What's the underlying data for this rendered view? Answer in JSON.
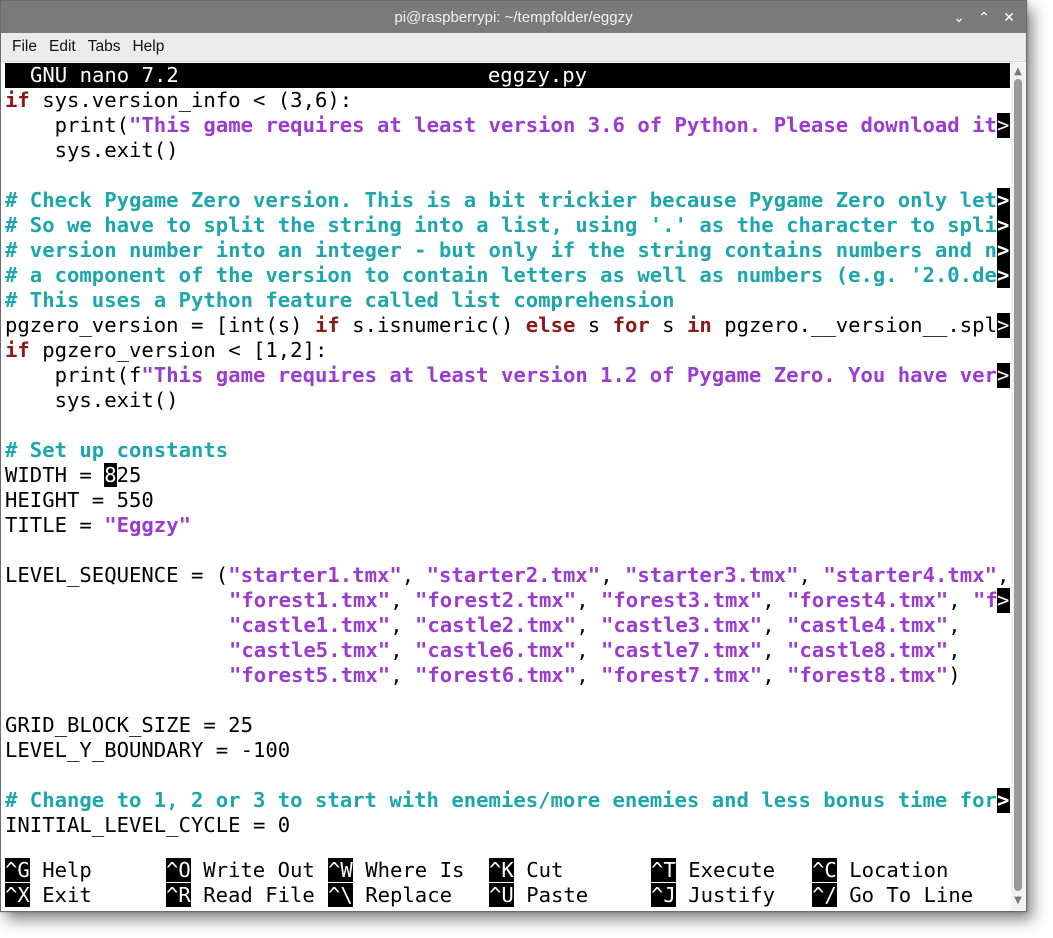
{
  "window": {
    "title": "pi@raspberrypi: ~/tempfolder/eggzy",
    "minimize_glyph": "⌄",
    "maximize_glyph": "⌃",
    "close_glyph": "✕"
  },
  "menu": [
    "File",
    "Edit",
    "Tabs",
    "Help"
  ],
  "nano": {
    "version": "GNU nano 7.2",
    "filename": "eggzy.py",
    "cursor_char": "8",
    "overflow_marker": ">"
  },
  "code": {
    "l1_a": "if",
    "l1_b": " sys.version_info < (3,6):",
    "l2_a": "    print(",
    "l2_b": "\"This game requires at least version 3.6 of Python. Please download it",
    "l3": "    sys.exit()",
    "l4": "",
    "c1": "# Check Pygame Zero version. This is a bit trickier because Pygame Zero only let",
    "c2": "# So we have to split the string into a list, using '.' as the character to spli",
    "c3": "# version number into an integer - but only if the string contains numbers and n",
    "c4": "# a component of the version to contain letters as well as numbers (e.g. '2.0.de",
    "c5": "# This uses a Python feature called list comprehension",
    "l10_a": "pgzero_version = [int(s) ",
    "l10_if": "if",
    "l10_b": " s.isnumeric() ",
    "l10_else": "else",
    "l10_c": " s ",
    "l10_for": "for",
    "l10_d": " s ",
    "l10_in": "in",
    "l10_e": " pgzero.__version__.spl",
    "l11_a": "if",
    "l11_b": " pgzero_version < [1,2]:",
    "l12_a": "    print(f",
    "l12_b": "\"This game requires at least version 1.2 of Pygame Zero. You have ver",
    "l13": "    sys.exit()",
    "c6": "# Set up constants",
    "l16_a": "WIDTH = ",
    "l16_b": "25",
    "l17": "HEIGHT = 550",
    "l18_a": "TITLE = ",
    "l18_b": "\"Eggzy\"",
    "ls_pre": "LEVEL_SEQUENCE = (",
    "ls1": [
      "\"starter1.tmx\"",
      ", ",
      "\"starter2.tmx\"",
      ", ",
      "\"starter3.tmx\"",
      ", ",
      "\"starter4.tmx\"",
      ","
    ],
    "ls2": [
      "\"forest1.tmx\"",
      ", ",
      "\"forest2.tmx\"",
      ", ",
      "\"forest3.tmx\"",
      ", ",
      "\"forest4.tmx\"",
      ", ",
      "\"f"
    ],
    "ls3": [
      "\"castle1.tmx\"",
      ", ",
      "\"castle2.tmx\"",
      ", ",
      "\"castle3.tmx\"",
      ", ",
      "\"castle4.tmx\"",
      ","
    ],
    "ls4": [
      "\"castle5.tmx\"",
      ", ",
      "\"castle6.tmx\"",
      ", ",
      "\"castle7.tmx\"",
      ", ",
      "\"castle8.tmx\"",
      ","
    ],
    "ls5": [
      "\"forest5.tmx\"",
      ", ",
      "\"forest6.tmx\"",
      ", ",
      "\"forest7.tmx\"",
      ", ",
      "\"forest8.tmx\"",
      ")"
    ],
    "l26": "GRID_BLOCK_SIZE = 25",
    "l27": "LEVEL_Y_BOUNDARY = -100",
    "c7": "# Change to 1, 2 or 3 to start with enemies/more enemies and less bonus time for",
    "l30": "INITIAL_LEVEL_CYCLE = 0"
  },
  "shortcuts": {
    "row1": [
      {
        "key": "^G",
        "label": " Help"
      },
      {
        "key": "^O",
        "label": " Write Out"
      },
      {
        "key": "^W",
        "label": " Where Is"
      },
      {
        "key": "^K",
        "label": " Cut"
      },
      {
        "key": "^T",
        "label": " Execute"
      },
      {
        "key": "^C",
        "label": " Location"
      }
    ],
    "row2": [
      {
        "key": "^X",
        "label": " Exit"
      },
      {
        "key": "^R",
        "label": " Read File"
      },
      {
        "key": "^\\",
        "label": " Replace"
      },
      {
        "key": "^U",
        "label": " Paste"
      },
      {
        "key": "^J",
        "label": " Justify"
      },
      {
        "key": "^/",
        "label": " Go To Line"
      }
    ]
  },
  "colors": {
    "keyword": "#8b1a1a",
    "string": "#9b3cd0",
    "comment": "#1ea6ad"
  }
}
